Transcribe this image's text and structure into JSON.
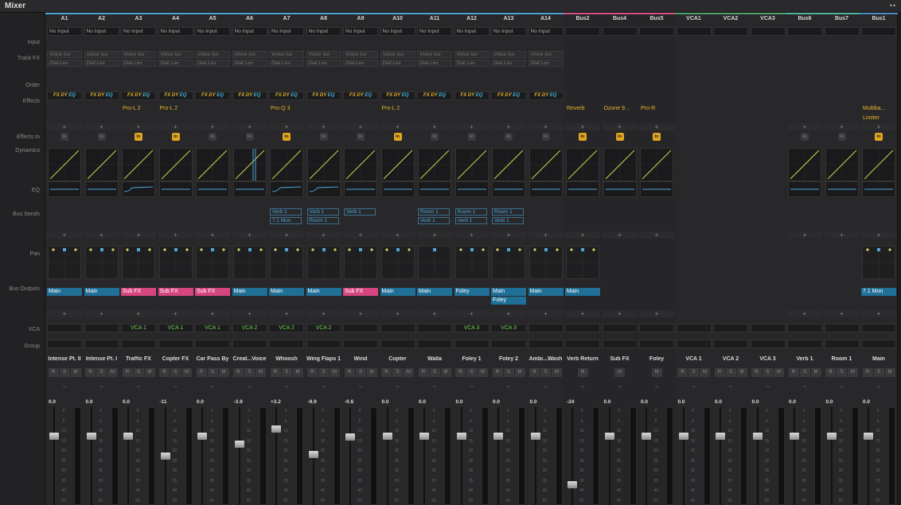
{
  "window": {
    "title": "Mixer",
    "options_label": "••"
  },
  "row_labels": [
    "Input",
    "Track FX",
    "Order",
    "Effects",
    "Effects In",
    "Dynamics",
    "EQ",
    "Bus Sends",
    "Pan",
    "Bus Outputs",
    "VCA",
    "Group"
  ],
  "colors": {
    "audio": "#4fa6d4",
    "bus": "#d94f88",
    "vca": "#4fa06a",
    "bus_out": "#4fb7a0",
    "output": "#4a8fc4",
    "effects": "#e8b52a",
    "sends": "#4fa6d4",
    "vca_label": "#6fcf52",
    "in_on": "#e0a521"
  },
  "order_label": {
    "fx": "FX",
    "dy": "DY",
    "eq": "EQ"
  },
  "add_symbol": "+",
  "rsm": [
    "R",
    "S",
    "M"
  ],
  "mute_only": "M",
  "automation_icon": "~",
  "fader_scale": [
    "0",
    "5",
    "10",
    "15",
    "20",
    "25",
    "30",
    "35",
    "40",
    "50"
  ],
  "channels": [
    {
      "name": "A1",
      "kind": "audio",
      "input": "No Input",
      "trackfx": [
        "Voice Iso",
        "Dial Lev"
      ],
      "order": true,
      "effects": [],
      "in_on": false,
      "dyn": true,
      "eq": "flat",
      "sends": [],
      "pan": "stereo",
      "outputs": [
        {
          "l": "Main",
          "c": "blue"
        }
      ],
      "vca": "",
      "track": "Intense Pt. II",
      "rsm": true,
      "vol": "0.0",
      "fader": 0.28
    },
    {
      "name": "A2",
      "kind": "audio",
      "input": "No Input",
      "trackfx": [
        "Voice Iso",
        "Dial Lev"
      ],
      "order": true,
      "effects": [],
      "in_on": false,
      "dyn": true,
      "eq": "flat",
      "sends": [],
      "pan": "stereo",
      "outputs": [
        {
          "l": "Main",
          "c": "blue"
        }
      ],
      "vca": "",
      "track": "Intense Pt. I",
      "rsm": true,
      "vol": "0.0",
      "fader": 0.28
    },
    {
      "name": "A3",
      "kind": "audio",
      "input": "No Input",
      "trackfx": [
        "Voice Iso",
        "Dial Lev"
      ],
      "order": true,
      "effects": [
        "Pro-L 2"
      ],
      "in_on": true,
      "dyn": true,
      "eq": "shelf",
      "sends": [],
      "pan": "stereo",
      "outputs": [
        {
          "l": "Sub FX",
          "c": "pink"
        }
      ],
      "vca": "VCA 1",
      "track": "Traffic FX",
      "rsm": true,
      "vol": "0.0",
      "fader": 0.28
    },
    {
      "name": "A4",
      "kind": "audio",
      "input": "No Input",
      "trackfx": [
        "Voice Iso",
        "Dial Lev"
      ],
      "order": true,
      "effects": [
        "Pro-L 2"
      ],
      "in_on": true,
      "dyn": true,
      "eq": "flat",
      "sends": [],
      "pan": "stereo",
      "outputs": [
        {
          "l": "Sub FX",
          "c": "pink"
        }
      ],
      "vca": "VCA 1",
      "track": "Copter FX",
      "rsm": true,
      "vol": "-11",
      "fader": 0.5
    },
    {
      "name": "A5",
      "kind": "audio",
      "input": "No Input",
      "trackfx": [
        "Voice Iso",
        "Dial Lev"
      ],
      "order": true,
      "effects": [],
      "in_on": false,
      "dyn": true,
      "eq": "flat",
      "sends": [],
      "pan": "stereo",
      "outputs": [
        {
          "l": "Sub FX",
          "c": "pink"
        }
      ],
      "vca": "VCA 1",
      "track": "Car Pass By",
      "rsm": true,
      "vol": "0.0",
      "fader": 0.28
    },
    {
      "name": "A6",
      "kind": "audio",
      "input": "No Input",
      "trackfx": [
        "Voice Iso",
        "Dial Lev"
      ],
      "order": true,
      "effects": [],
      "in_on": false,
      "dyn": true,
      "eq": "flat",
      "sends": [],
      "pan": "stereo",
      "outputs": [
        {
          "l": "Main",
          "c": "blue"
        }
      ],
      "vca": "VCA 2",
      "track": "Creat...Voice",
      "rsm": true,
      "vol": "-3.9",
      "fader": 0.37
    },
    {
      "name": "A7",
      "kind": "audio",
      "input": "No Input",
      "trackfx": [
        "Voice Iso",
        "Dial Lev"
      ],
      "order": true,
      "effects": [
        "Pro-Q 3"
      ],
      "in_on": true,
      "dyn": true,
      "eq": "shelf",
      "sends": [
        "Verb 1",
        "7.1 Mon"
      ],
      "pan": "stereo",
      "outputs": [
        {
          "l": "Main",
          "c": "blue"
        }
      ],
      "vca": "VCA 2",
      "track": "Whoosh",
      "rsm": true,
      "vol": "+3.2",
      "fader": 0.2
    },
    {
      "name": "A8",
      "kind": "audio",
      "input": "No Input",
      "trackfx": [
        "Voice Iso",
        "Dial Lev"
      ],
      "order": true,
      "effects": [],
      "in_on": false,
      "dyn": true,
      "eq": "shelf",
      "sends": [
        "Verb 1",
        "Room 1"
      ],
      "pan": "stereo",
      "outputs": [
        {
          "l": "Main",
          "c": "blue"
        }
      ],
      "vca": "VCA 2",
      "track": "Wing Flaps 1",
      "rsm": true,
      "vol": "-9.9",
      "fader": 0.48
    },
    {
      "name": "A9",
      "kind": "audio",
      "input": "No Input",
      "trackfx": [
        "Voice Iso",
        "Dial Lev"
      ],
      "order": true,
      "effects": [],
      "in_on": false,
      "dyn": true,
      "eq": "flat",
      "sends": [
        "Verb 1"
      ],
      "pan": "stereo",
      "outputs": [
        {
          "l": "Sub FX",
          "c": "pink"
        }
      ],
      "vca": "",
      "track": "Wind",
      "rsm": true,
      "vol": "-0.6",
      "fader": 0.29
    },
    {
      "name": "A10",
      "kind": "audio",
      "input": "No Input",
      "trackfx": [
        "Voice Iso",
        "Dial Lev"
      ],
      "order": true,
      "effects": [
        "Pro-L 2"
      ],
      "in_on": true,
      "dyn": true,
      "eq": "flat",
      "sends": [],
      "pan": "stereo",
      "outputs": [
        {
          "l": "Main",
          "c": "blue"
        }
      ],
      "vca": "",
      "track": "Copter",
      "rsm": true,
      "vol": "0.0",
      "fader": 0.28
    },
    {
      "name": "A11",
      "kind": "audio",
      "input": "No Input",
      "trackfx": [
        "Voice Iso",
        "Dial Lev"
      ],
      "order": true,
      "effects": [],
      "in_on": false,
      "dyn": true,
      "eq": "flat",
      "sends": [
        "Room 1",
        "Verb 1"
      ],
      "pan": "mono",
      "outputs": [
        {
          "l": "Main",
          "c": "blue"
        }
      ],
      "vca": "",
      "track": "Walla",
      "rsm": true,
      "vol": "0.0",
      "fader": 0.28
    },
    {
      "name": "A12",
      "kind": "audio",
      "input": "No Input",
      "trackfx": [
        "Voice Iso",
        "Dial Lev"
      ],
      "order": true,
      "effects": [],
      "in_on": false,
      "dyn": true,
      "eq": "flat",
      "sends": [
        "Room 1",
        "Verb 1"
      ],
      "pan": "stereo",
      "outputs": [
        {
          "l": "Foley",
          "c": "blue"
        }
      ],
      "vca": "VCA 3",
      "track": "Foley 1",
      "rsm": true,
      "vol": "0.0",
      "fader": 0.28
    },
    {
      "name": "A13",
      "kind": "audio",
      "input": "No Input",
      "trackfx": [
        "Voice Iso",
        "Dial Lev"
      ],
      "order": true,
      "effects": [],
      "in_on": false,
      "dyn": true,
      "eq": "flat",
      "sends": [
        "Room 1",
        "Verb 1"
      ],
      "pan": "stereo",
      "outputs": [
        {
          "l": "Main",
          "c": "blue"
        },
        {
          "l": "Foley",
          "c": "blue"
        }
      ],
      "vca": "VCA 3",
      "track": "Foley 2",
      "rsm": true,
      "vol": "0.0",
      "fader": 0.28
    },
    {
      "name": "A14",
      "kind": "audio",
      "input": "No Input",
      "trackfx": [
        "Voice Iso",
        "Dial Lev"
      ],
      "order": true,
      "effects": [],
      "in_on": false,
      "dyn": true,
      "eq": "flat",
      "sends": [],
      "pan": "stereo",
      "outputs": [
        {
          "l": "Main",
          "c": "blue"
        }
      ],
      "vca": "",
      "track": "Ambi...Wash",
      "rsm": true,
      "vol": "0.0",
      "fader": 0.28
    },
    {
      "name": "Bus2",
      "kind": "bus",
      "input": "",
      "trackfx": [],
      "order": false,
      "effects": [
        "Reverb"
      ],
      "in_on": true,
      "dyn": true,
      "eq": "flat",
      "sends": [],
      "pan": "stereo",
      "outputs": [
        {
          "l": "Main",
          "c": "blue"
        }
      ],
      "vca": "",
      "track": "Verb Return",
      "rsm": false,
      "vol": "-24",
      "fader": 0.82
    },
    {
      "name": "Bus4",
      "kind": "bus",
      "input": "",
      "trackfx": [],
      "order": false,
      "effects": [
        "Ozone 9..."
      ],
      "in_on": true,
      "dyn": true,
      "eq": "flat",
      "sends": [],
      "pan": "",
      "outputs": [],
      "vca": "",
      "track": "Sub FX",
      "rsm": false,
      "vol": "0.0",
      "fader": 0.28
    },
    {
      "name": "Bus5",
      "kind": "bus",
      "input": "",
      "trackfx": [],
      "order": false,
      "effects": [
        "Pro-R"
      ],
      "in_on": true,
      "dyn": true,
      "eq": "flat",
      "sends": [],
      "pan": "",
      "outputs": [],
      "vca": "",
      "track": "Foley",
      "rsm": false,
      "vol": "0.0",
      "fader": 0.28
    },
    {
      "name": "VCA1",
      "kind": "vca",
      "input": "",
      "trackfx": [],
      "order": false,
      "effects": [],
      "in_on": null,
      "dyn": false,
      "eq": "",
      "sends": [],
      "pan": "",
      "outputs": [],
      "vca": "",
      "track": "VCA 1",
      "rsm": true,
      "vol": "0.0",
      "fader": 0.28
    },
    {
      "name": "VCA2",
      "kind": "vca",
      "input": "",
      "trackfx": [],
      "order": false,
      "effects": [],
      "in_on": null,
      "dyn": false,
      "eq": "",
      "sends": [],
      "pan": "",
      "outputs": [],
      "vca": "",
      "track": "VCA 2",
      "rsm": true,
      "vol": "0.0",
      "fader": 0.28
    },
    {
      "name": "VCA3",
      "kind": "vca",
      "input": "",
      "trackfx": [],
      "order": false,
      "effects": [],
      "in_on": null,
      "dyn": false,
      "eq": "",
      "sends": [],
      "pan": "",
      "outputs": [],
      "vca": "",
      "track": "VCA 3",
      "rsm": true,
      "vol": "0.0",
      "fader": 0.28
    },
    {
      "name": "Bus6",
      "kind": "bus2",
      "input": "",
      "trackfx": [],
      "order": false,
      "effects": [],
      "in_on": false,
      "dyn": true,
      "eq": "flat",
      "sends": [],
      "pan": "",
      "outputs": [],
      "vca": "",
      "track": "Verb 1",
      "rsm": true,
      "vol": "0.0",
      "fader": 0.28
    },
    {
      "name": "Bus7",
      "kind": "bus2",
      "input": "",
      "trackfx": [],
      "order": false,
      "effects": [],
      "in_on": false,
      "dyn": true,
      "eq": "flat",
      "sends": [],
      "pan": "",
      "outputs": [],
      "vca": "",
      "track": "Room 1",
      "rsm": true,
      "vol": "0.0",
      "fader": 0.28
    },
    {
      "name": "Bus1",
      "kind": "main",
      "input": "",
      "trackfx": [],
      "order": false,
      "effects": [
        "Multiba...",
        "Limiter"
      ],
      "in_on": true,
      "dyn": true,
      "eq": "flat",
      "sends": [],
      "pan": "stereo",
      "outputs": [
        {
          "l": "7.1 Mon",
          "c": "blue"
        }
      ],
      "vca": "",
      "track": "Main",
      "rsm": true,
      "vol": "0.0",
      "fader": 0.28
    }
  ]
}
